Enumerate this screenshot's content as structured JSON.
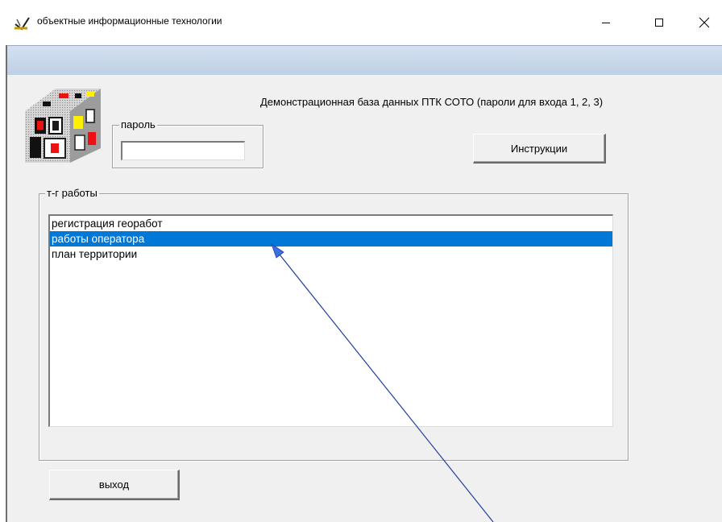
{
  "window": {
    "title": "объектные информационные технологии",
    "controls": [
      "minimize-icon",
      "maximize-icon",
      "close-icon"
    ]
  },
  "header": {
    "description": "Демонстрационная база данных ПТК СОТО (пароли для входа 1, 2, 3)"
  },
  "password": {
    "legend": "пароль",
    "value": ""
  },
  "instructions_button": {
    "label": "Инструкции"
  },
  "work_group": {
    "legend": "т-г работы",
    "items": [
      {
        "label": "регистрация георабот",
        "selected": false
      },
      {
        "label": "работы оператора",
        "selected": true
      },
      {
        "label": "план территории",
        "selected": false
      }
    ]
  },
  "exit_button": {
    "label": "выход"
  },
  "colors": {
    "selection": "#0078d7",
    "client_background": "#f0f0f0",
    "menubar": "#c8d8ec",
    "annotation_arrow": "#1f3f9f"
  }
}
